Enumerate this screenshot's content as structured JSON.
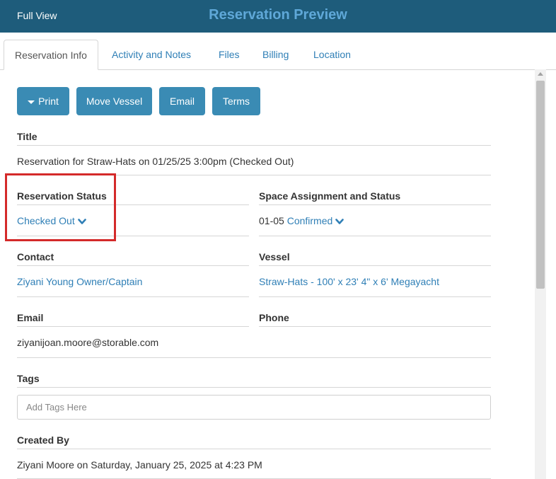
{
  "header": {
    "full_view": "Full View",
    "title": "Reservation Preview"
  },
  "tabs": [
    {
      "label": "Reservation Info",
      "active": true
    },
    {
      "label": "Activity and Notes",
      "active": false
    },
    {
      "label": "Files",
      "active": false
    },
    {
      "label": "Billing",
      "active": false
    },
    {
      "label": "Location",
      "active": false
    }
  ],
  "actions": {
    "print": "Print",
    "move_vessel": "Move Vessel",
    "email": "Email",
    "terms": "Terms"
  },
  "fields": {
    "title": {
      "label": "Title",
      "value": "Reservation for Straw-Hats on 01/25/25 3:00pm (Checked Out)"
    },
    "reservation_status": {
      "label": "Reservation Status",
      "value": "Checked Out"
    },
    "space_assignment": {
      "label": "Space Assignment and Status",
      "space": "01-05",
      "status": "Confirmed"
    },
    "contact": {
      "label": "Contact",
      "value": "Ziyani Young Owner/Captain"
    },
    "vessel": {
      "label": "Vessel",
      "value": "Straw-Hats - 100' x 23' 4\" x 6' Megayacht"
    },
    "email": {
      "label": "Email",
      "value": "ziyanijoan.moore@storable.com"
    },
    "phone": {
      "label": "Phone",
      "value": ""
    },
    "tags": {
      "label": "Tags",
      "placeholder": "Add Tags Here"
    },
    "created_by": {
      "label": "Created By",
      "value": "Ziyani Moore on Saturday, January 25, 2025 at 4:23 PM"
    }
  },
  "colors": {
    "header_bg": "#1e5c7b",
    "title_text": "#5fa8d8",
    "button_bg": "#3a8bb4",
    "link": "#2f7fb6",
    "highlight": "#d42a2a"
  },
  "icons": {
    "print_caret": "caret-down-icon",
    "status_chevron": "chevron-down-icon",
    "scroll_up": "arrow-up-icon"
  }
}
